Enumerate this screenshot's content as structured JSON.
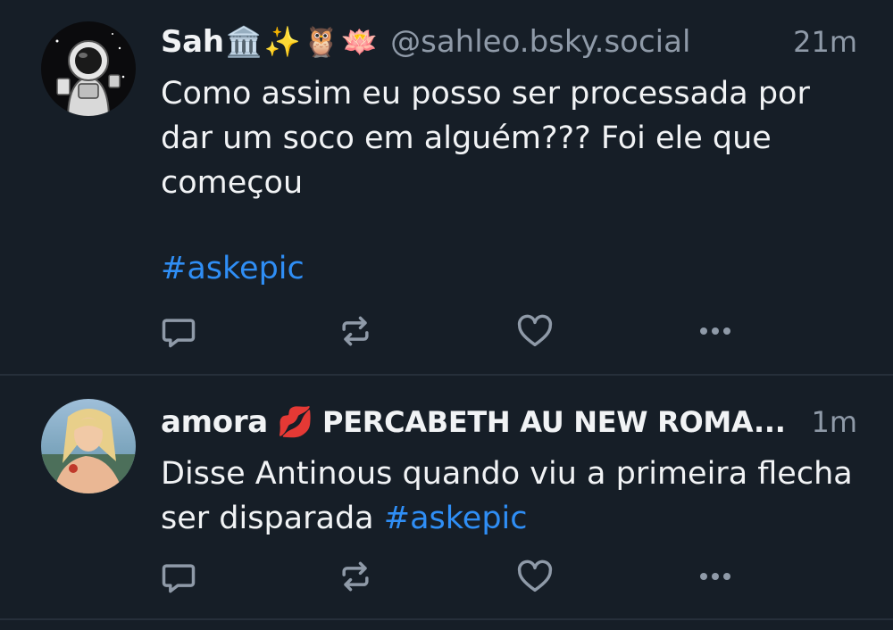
{
  "posts": [
    {
      "display_name": "Sah",
      "emojis": [
        "🏛️",
        "✨",
        "🦉",
        "🪷"
      ],
      "handle": "@sahleo.bsky.social",
      "time": "21m",
      "text": "Como assim eu posso ser processada por dar um soco em alguém??? Foi ele que começou",
      "hashtag": "#askepic"
    },
    {
      "display_name": "amora",
      "emoji": "💋",
      "name_rest": "PERCABETH AU NEW ROMA...",
      "time": "1m",
      "text": "Disse Antinous quando viu a primeira flecha ser disparada",
      "hashtag": "#askepic"
    }
  ],
  "icons": {
    "reply": "reply-icon",
    "repost": "repost-icon",
    "like": "heart-icon",
    "more": "more-options-icon"
  },
  "colors": {
    "background": "#161e27",
    "text": "#f1f3f5",
    "muted": "#8f9aa8",
    "link": "#2f8ef5",
    "divider": "#262f3a"
  }
}
